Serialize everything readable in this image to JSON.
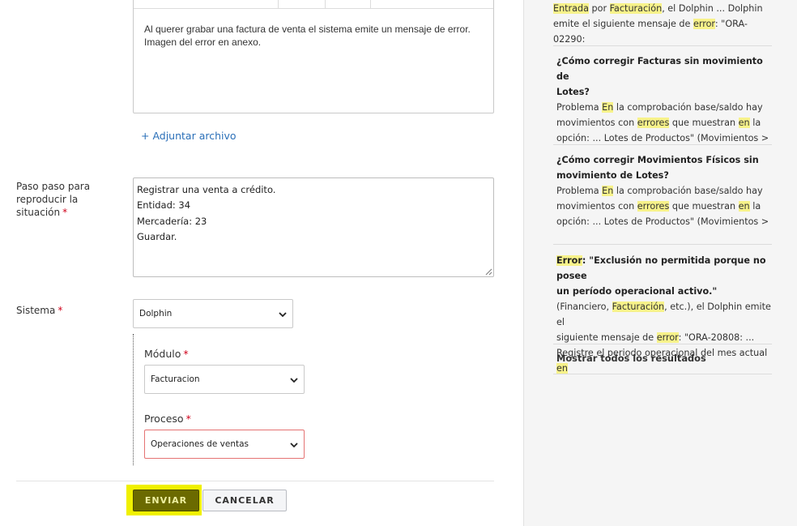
{
  "form": {
    "description_text": "Al querer grabar una factura de venta el sistema emite un mensaje de error. Imagen del error en anexo.",
    "attach_link": "+ Adjuntar archivo",
    "steps_label": "Paso paso para reproducir la situación",
    "steps_lines": [
      "Registrar una venta a crédito.",
      "Entidad: 34",
      "Mercadería: 23",
      "Guardar."
    ],
    "sistema_label": "Sistema",
    "sistema_value": "Dolphin",
    "modulo_label": "Módulo",
    "modulo_value": "Facturacion",
    "proceso_label": "Proceso",
    "proceso_value": "Operaciones de ventas",
    "required_mark": "*",
    "send_label": "ENVIAR",
    "cancel_label": "CANCELAR"
  },
  "results": {
    "r0": {
      "l1a": "Entrada",
      "l1b": " por ",
      "l1c": "Facturación",
      "l1d": ", el Dolphin ... Dolphin",
      "l2a": "emite el siguiente mensaje de ",
      "l2b": "error",
      "l2c": ": \"ORA-02290:"
    },
    "r1": {
      "title1": "¿Cómo corregir Facturas sin movimiento de",
      "title2": "Lotes?",
      "l1a": "Problema ",
      "l1b": "En",
      "l1c": " la comprobación base/saldo hay",
      "l2a": "movimientos con ",
      "l2b": "errores",
      "l2c": " que muestran ",
      "l2d": "en",
      "l2e": " la",
      "l3": "opción: ... Lotes de Productos\" (Movimientos >"
    },
    "r2": {
      "title1": "¿Cómo corregir Movimientos Físicos sin",
      "title2": "movimiento de Lotes?",
      "l1a": "Problema ",
      "l1b": "En",
      "l1c": " la comprobación base/saldo hay",
      "l2a": "movimientos con ",
      "l2b": "errores",
      "l2c": " que muestran ",
      "l2d": "en",
      "l2e": " la",
      "l3": "opción: ... Lotes de Productos\" (Movimientos >"
    },
    "r3": {
      "title1a": "Error",
      "title1b": ": \"Exclusión no permitida porque no posee",
      "title2": "un período operacional activo.\"",
      "l1a": "(Financiero, ",
      "l1b": "Facturación",
      "l1c": ", etc.), el Dolphin emite el",
      "l2a": "siguiente mensaje de ",
      "l2b": "error",
      "l2c": ": \"ORA-20808: ...",
      "l3a": "Registre el periodo operacional del mes actual ",
      "l3b": "en"
    },
    "show_all": "Mostrar todos los resultados"
  }
}
